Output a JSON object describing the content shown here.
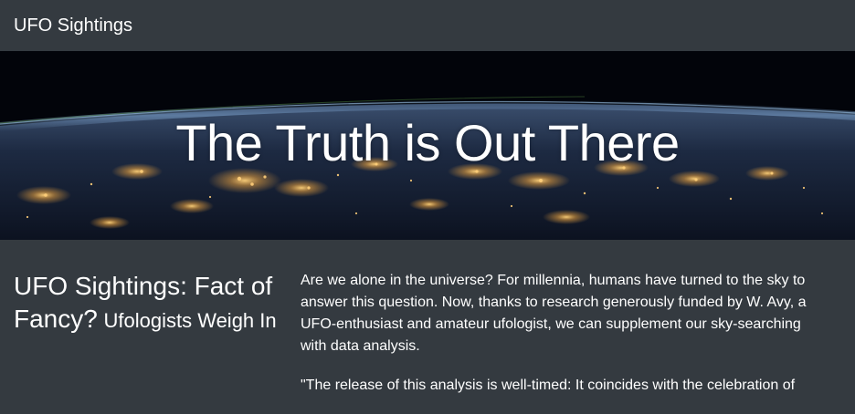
{
  "navbar": {
    "brand": "UFO Sightings"
  },
  "hero": {
    "title": "The Truth is Out There"
  },
  "article": {
    "headline_main": "UFO Sightings: Fact of Fancy?",
    "headline_sub": "Ufologists Weigh In",
    "paragraphs": [
      "Are we alone in the universe? For millennia, humans have turned to the sky to answer this question. Now, thanks to research generously funded by W. Avy, a UFO-enthusiast and amateur ufologist, we can supplement our sky-searching with data analysis.",
      "\"The release of this analysis is well-timed: It coincides with the celebration of"
    ]
  }
}
